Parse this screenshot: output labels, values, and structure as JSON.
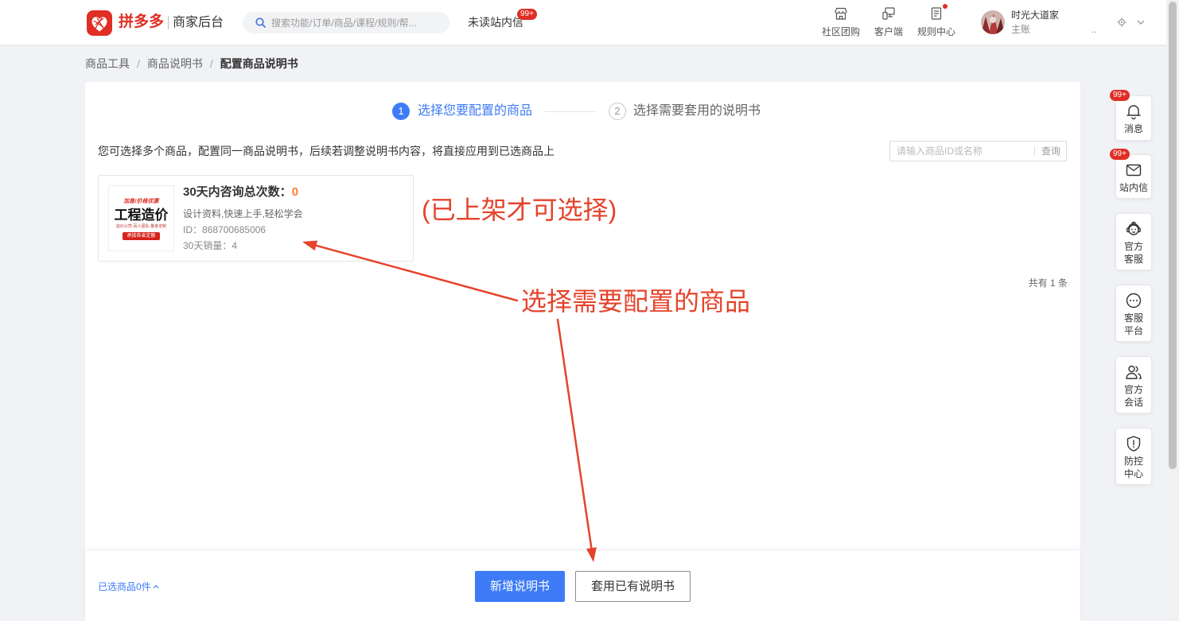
{
  "colors": {
    "brand": "#e02e24",
    "accent": "#3d7bf7",
    "highlight": "#ff7a2f",
    "annotation": "#e5432c"
  },
  "header": {
    "logo_icon": "pinduoduo-logo-icon",
    "logo_text": "拼多多",
    "subtitle": "商家后台",
    "search": {
      "placeholder": "搜索功能/订单/商品/课程/规则/帮...",
      "icon": "search-icon"
    },
    "unread": {
      "label": "未读站内信",
      "badge": "99+"
    },
    "nav": [
      {
        "label": "社区团购",
        "icon": "store-icon"
      },
      {
        "label": "客户端",
        "icon": "devices-icon"
      },
      {
        "label": "规则中心",
        "icon": "document-icon",
        "has_dot": true
      }
    ],
    "user": {
      "name": "时光大道家",
      "account": "主账",
      "ellipsis": ".."
    }
  },
  "breadcrumb": {
    "separator": "/",
    "items": [
      "商品工具",
      "商品说明书",
      "配置商品说明书"
    ]
  },
  "steps": [
    {
      "num": "1",
      "label": "选择您要配置的商品",
      "active": true
    },
    {
      "num": "2",
      "label": "选择需要套用的说明书",
      "active": false
    }
  ],
  "description": "您可选择多个商品，配置同一商品说明书，后续若调整说明书内容，将直接应用到已选商品上",
  "search": {
    "placeholder": "请输入商品ID或名称",
    "button": "查询"
  },
  "product": {
    "consult_label": "30天内咨询总次数：",
    "consult_count": "0",
    "subtitle": "设计资料,快速上手,轻松学会",
    "id_label": "ID：",
    "id": "868700685006",
    "sales_label": "30天销量：",
    "sales": "4",
    "image": {
      "banner": "加急!价格优惠",
      "title": "工程造价",
      "tagline": "造价公司·百人团队·量身定制",
      "ribbon": "承接各省定额"
    }
  },
  "total": "共有 1 条",
  "annotations": {
    "status_note": "(已上架才可选择)",
    "instruction": "选择需要配置的商品"
  },
  "footer": {
    "selected_prefix": "已选商品",
    "selected_count": "0",
    "selected_suffix": "件",
    "primary_button": "新增说明书",
    "secondary_button": "套用已有说明书"
  },
  "sidebar": [
    {
      "lines": [
        "消息"
      ],
      "icon": "bell-icon",
      "badge": "99+"
    },
    {
      "lines": [
        "站内信"
      ],
      "icon": "mail-icon",
      "badge": "99+"
    },
    {
      "lines": [
        "官方",
        "客服"
      ],
      "icon": "customer-service-icon"
    },
    {
      "lines": [
        "客服",
        "平台"
      ],
      "icon": "chat-icon"
    },
    {
      "lines": [
        "官方",
        "会话"
      ],
      "icon": "contacts-icon"
    },
    {
      "lines": [
        "防控",
        "中心"
      ],
      "icon": "shield-alert-icon"
    }
  ]
}
